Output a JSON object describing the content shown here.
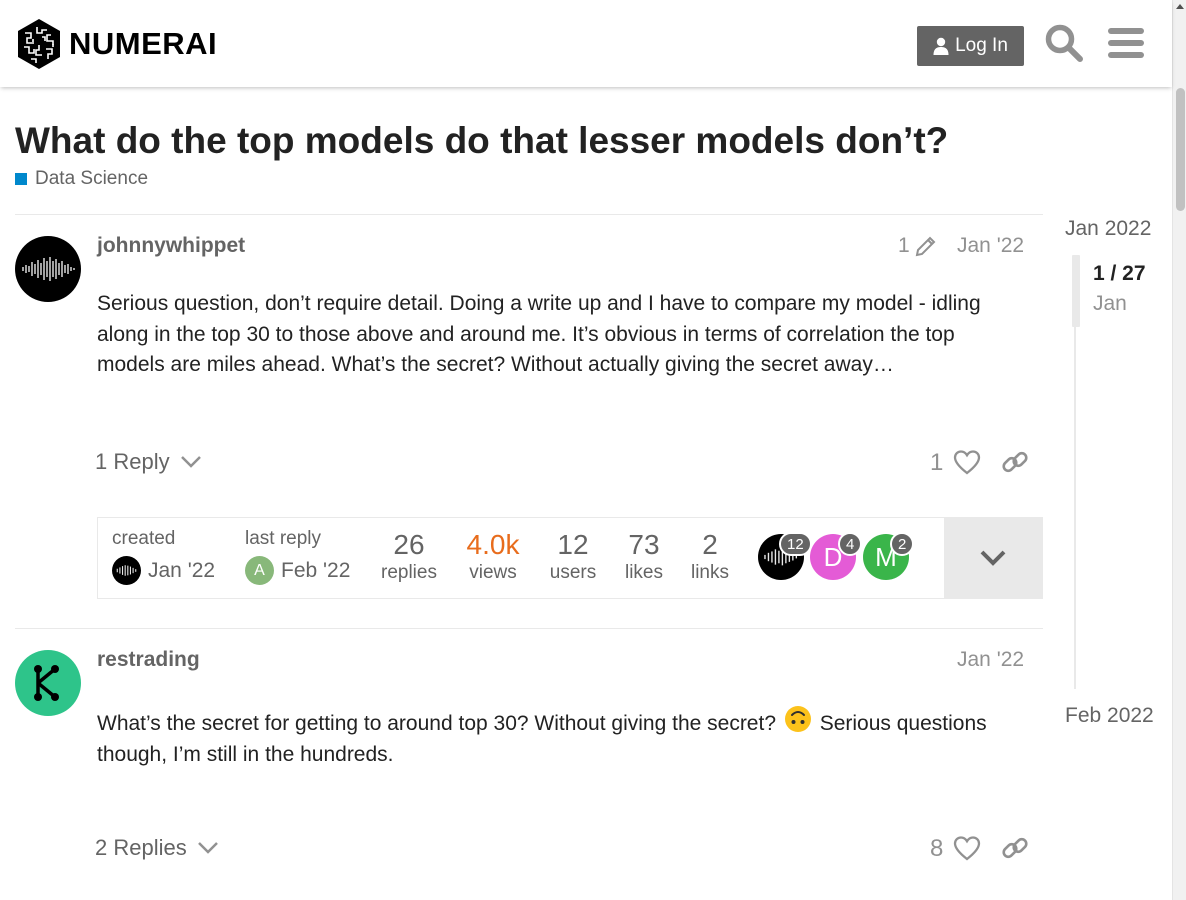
{
  "header": {
    "logo_text": "NUMERAI",
    "login_label": "Log In"
  },
  "topic": {
    "title": "What do the top models do that lesser models don’t?",
    "category": "Data Science",
    "category_color": "#0088cc"
  },
  "posts": [
    {
      "username": "johnnywhippet",
      "edit_count": "1",
      "date": "Jan '22",
      "body": "Serious question, don’t require detail. Doing a write up and I have to compare my model - idling along in the top 30 to those above and around me. It’s obvious in terms of correlation the top models are miles ahead. What’s the secret? Without actually giving the secret away…",
      "replies_label": "1 Reply",
      "likes": "1"
    },
    {
      "username": "restrading",
      "date": "Jan '22",
      "body_before": "What’s the secret for getting to around top 30? Without giving the secret?",
      "emoji": "upside-down-face",
      "body_after": "Serious questions though, I’m still in the hundreds.",
      "replies_label": "2 Replies",
      "likes": "8"
    }
  ],
  "topic_map": {
    "created_label": "created",
    "created_date": "Jan '22",
    "last_reply_label": "last reply",
    "last_reply_date": "Feb '22",
    "last_reply_avatar_letter": "A",
    "stats": [
      {
        "value": "26",
        "label": "replies"
      },
      {
        "value": "4.0k",
        "label": "views"
      },
      {
        "value": "12",
        "label": "users"
      },
      {
        "value": "73",
        "label": "likes"
      },
      {
        "value": "2",
        "label": "links"
      }
    ],
    "views_color": "#e45735",
    "participants": [
      {
        "letter": "",
        "count": "12"
      },
      {
        "letter": "D",
        "count": "4",
        "color": "#e45bd6"
      },
      {
        "letter": "M",
        "count": "2",
        "color": "#3ab54a"
      }
    ]
  },
  "timeline": {
    "start": "Jan 2022",
    "position": "1 / 27",
    "month": "Jan",
    "end": "Feb 2022"
  }
}
